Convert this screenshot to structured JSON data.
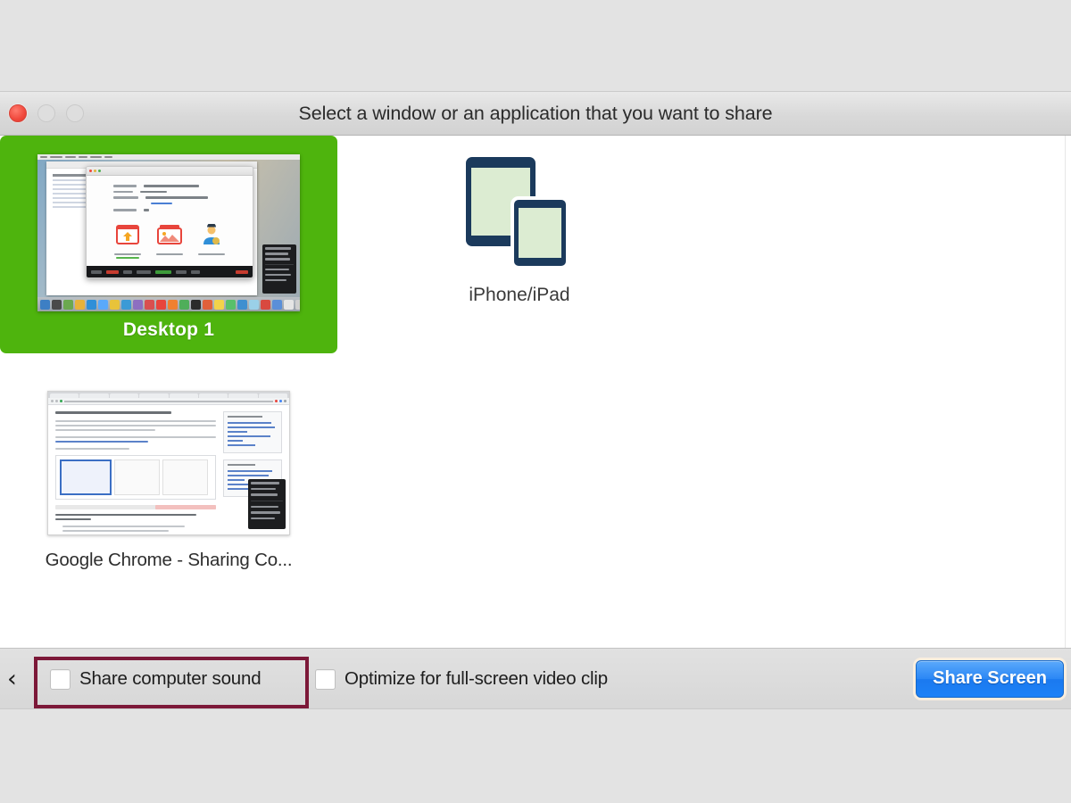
{
  "window": {
    "title": "Select a window or an application that you want to share",
    "traffic_lights": {
      "close": "close",
      "minimize": "minimize",
      "maximize": "maximize"
    }
  },
  "share_sources": [
    {
      "id": "desktop-1",
      "label": "Desktop 1",
      "selected": true,
      "type": "desktop"
    },
    {
      "id": "iphone-ipad",
      "label": "iPhone/iPad",
      "selected": false,
      "type": "device"
    },
    {
      "id": "google-chrome",
      "label": "Google Chrome - Sharing Co...",
      "selected": false,
      "type": "window"
    }
  ],
  "bottom_bar": {
    "back_chevron": "‹",
    "options": [
      {
        "id": "share-computer-sound",
        "label": "Share computer sound",
        "checked": false,
        "highlighted": true
      },
      {
        "id": "optimize-video-clip",
        "label": "Optimize for full-screen video clip",
        "checked": false,
        "highlighted": false
      }
    ],
    "primary_button": "Share Screen"
  },
  "colors": {
    "selection_green": "#4eb40d",
    "highlight_outline": "#7c1838",
    "primary_button_blue": "#2b87f5",
    "device_icon_navy": "#1b3a5c",
    "device_icon_screen": "#dcecd2",
    "window_background": "#ffffff",
    "chrome_background": "#e3e3e3"
  },
  "icons": {
    "back": "chevron-left-icon",
    "device": "iphone-ipad-icon",
    "checkbox": "checkbox-icon"
  }
}
